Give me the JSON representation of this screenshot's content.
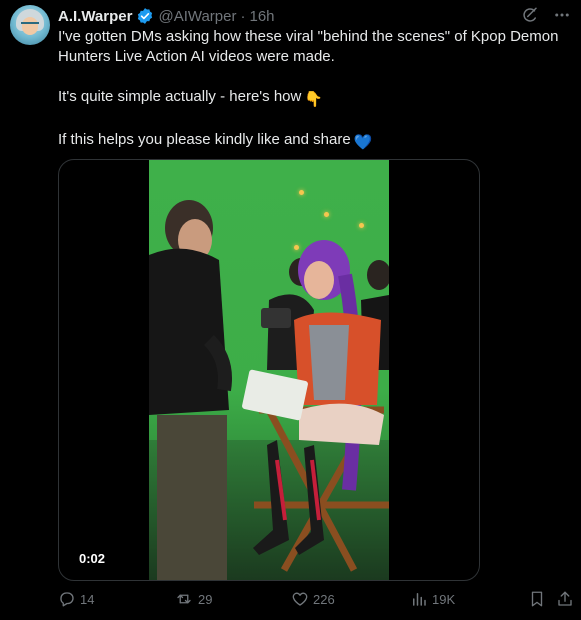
{
  "post": {
    "author_name": "A.I.Warper",
    "handle": "@AIWarper",
    "separator": "·",
    "time": "16h",
    "paragraphs": [
      "I've gotten DMs asking how these viral \"behind the scenes\" of Kpop Demon Hunters Live Action AI videos were made.",
      "It's quite simple actually - here's how",
      "If this helps you please kindly like and share"
    ],
    "emoji_pointing": "👇",
    "emoji_heart": "💙"
  },
  "video": {
    "timestamp": "0:02"
  },
  "actions": {
    "replies": "14",
    "reposts": "29",
    "likes": "226",
    "views": "19K"
  },
  "colors": {
    "background": "#000000",
    "text": "#e7e9ea",
    "muted": "#71767b",
    "verified": "#1d9bf0",
    "green_screen": "#3fb04a",
    "border": "#2f3336"
  },
  "icons": {
    "verified": "verified-badge-icon",
    "grok": "grok-icon",
    "more": "more-icon",
    "reply": "reply-icon",
    "repost": "repost-icon",
    "like": "heart-icon",
    "views": "views-icon",
    "bookmark": "bookmark-icon",
    "share": "share-icon"
  }
}
